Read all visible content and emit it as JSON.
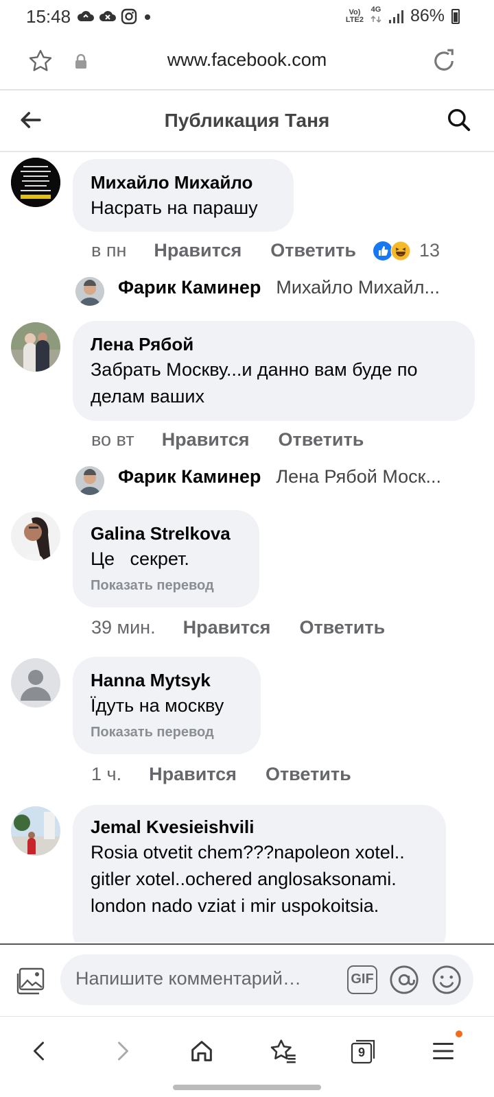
{
  "status_bar": {
    "time": "15:48",
    "volte_line1": "Vo)",
    "volte_line2": "LTE2",
    "network": "4G",
    "battery": "86%"
  },
  "browser": {
    "url": "www.facebook.com"
  },
  "header": {
    "title": "Публикация Таня"
  },
  "comments": [
    {
      "name": "Михайло Михайло",
      "text": "Насрать на парашу",
      "time": "в пн",
      "like_label": "Нравится",
      "reply_label": "Ответить",
      "reaction_count": "13",
      "reply_preview": {
        "name": "Фарик Каминер",
        "text": "Михайло Михайл..."
      }
    },
    {
      "name": "Лена Рябой",
      "text": "Забрать Москву...и данно вам буде по делам ваших",
      "time": "во вт",
      "like_label": "Нравится",
      "reply_label": "Ответить",
      "reply_preview": {
        "name": "Фарик Каминер",
        "text": "Лена Рябой Моск..."
      }
    },
    {
      "name": "Galina Strelkova",
      "text": "Це   секрет.",
      "translate": "Показать перевод",
      "time": "39 мин.",
      "like_label": "Нравится",
      "reply_label": "Ответить"
    },
    {
      "name": "Hanna Mytsyk",
      "text": "Їдуть на москву",
      "translate": "Показать перевод",
      "time": "1 ч.",
      "like_label": "Нравится",
      "reply_label": "Ответить"
    },
    {
      "name": "Jemal Kvesieishvili",
      "text": "Rosia otvetit chem???napoleon xotel.. gitler xotel..ochered anglosaksonami. london nado vziat i mir uspokoitsia."
    }
  ],
  "composer": {
    "placeholder": "Напишите комментарий…",
    "gif_label": "GIF"
  },
  "nav": {
    "tab_count": "9"
  },
  "colors": {
    "bubble": "#f0f2f5",
    "meta": "#65676b",
    "like_blue": "#1877f2",
    "haha_yellow": "#f7b928",
    "badge_orange": "#f26b1d"
  }
}
